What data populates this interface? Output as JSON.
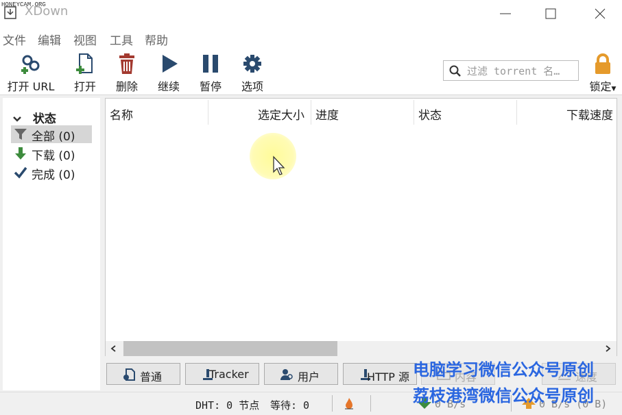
{
  "watermark": "HONEYCAM.ORG",
  "window": {
    "title": "XDown"
  },
  "menu": [
    "文件",
    "编辑",
    "视图",
    "工具",
    "帮助"
  ],
  "toolbar": {
    "open_url": "打开 URL",
    "open": "打开",
    "delete": "删除",
    "resume": "继续",
    "pause": "暂停",
    "options": "选项",
    "filter_placeholder": "过滤 torrent 名…",
    "lock": "锁定"
  },
  "sidebar": {
    "header": "状态",
    "items": [
      {
        "label": "全部 (0)",
        "icon": "filter-icon",
        "selected": true
      },
      {
        "label": "下载 (0)",
        "icon": "arrow-down-icon"
      },
      {
        "label": "完成 (0)",
        "icon": "check-icon"
      }
    ]
  },
  "table": {
    "columns": [
      "名称",
      "选定大小",
      "进度",
      "状态",
      "下载速度"
    ],
    "rows": []
  },
  "tabs": [
    "普通",
    "Tracker",
    "用户",
    "HTTP 源",
    "内容",
    "速度"
  ],
  "status": {
    "dht": "DHT: 0 节点",
    "waiting": "等待: 0",
    "down": "0 B/s",
    "up": "0 B/s (0 B)"
  },
  "overlay": {
    "line1": "电脑学习微信公众号原创",
    "line2": "荔枝港湾微信公众号原创"
  },
  "colors": {
    "accent_green": "#3d8b3d",
    "delete_red": "#a33a30",
    "toolbar_blue": "#2a4a6e",
    "lock_orange": "#e59a2b",
    "overlay_blue": "#2a66e0"
  }
}
